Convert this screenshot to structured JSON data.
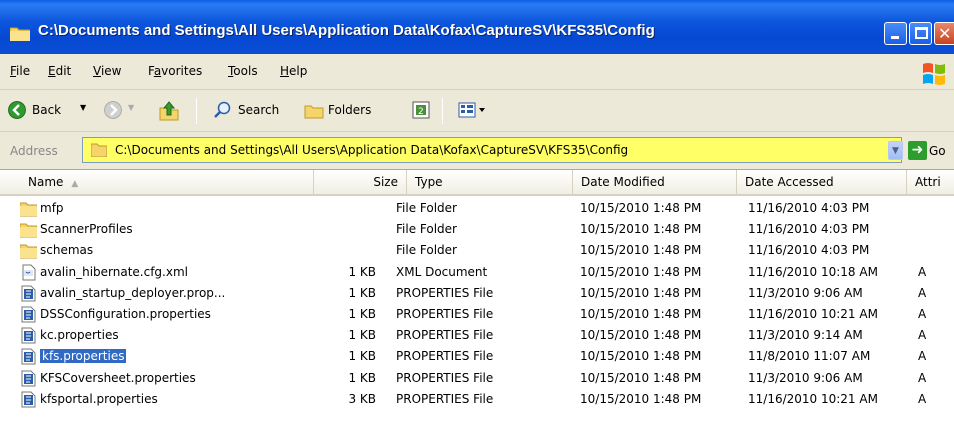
{
  "window": {
    "title": "C:\\Documents and Settings\\All Users\\Application Data\\Kofax\\CaptureSV\\KFS35\\Config"
  },
  "menu": [
    {
      "label": "File",
      "key": "F",
      "rest": "ile"
    },
    {
      "label": "Edit",
      "key": "E",
      "rest": "dit"
    },
    {
      "label": "View",
      "key": "V",
      "rest": "iew"
    },
    {
      "label": "Favorites",
      "key": "a",
      "rest": "vorites",
      "prefix": "F"
    },
    {
      "label": "Tools",
      "key": "T",
      "rest": "ools"
    },
    {
      "label": "Help",
      "key": "H",
      "rest": "elp"
    }
  ],
  "toolbar": {
    "back_label": "Back",
    "search_label": "Search",
    "folders_label": "Folders"
  },
  "address": {
    "label": "Address",
    "value": "C:\\Documents and Settings\\All Users\\Application Data\\Kofax\\CaptureSV\\KFS35\\Config",
    "go_label": "Go"
  },
  "columns": {
    "name": "Name",
    "size": "Size",
    "type": "Type",
    "modified": "Date Modified",
    "accessed": "Date Accessed",
    "attributes": "Attri"
  },
  "files": [
    {
      "name": "mfp",
      "size": "",
      "type": "File Folder",
      "modified": "10/15/2010 1:48 PM",
      "accessed": "11/16/2010 4:03 PM",
      "attr": "",
      "icon": "folder-icon"
    },
    {
      "name": "ScannerProfiles",
      "size": "",
      "type": "File Folder",
      "modified": "10/15/2010 1:48 PM",
      "accessed": "11/16/2010 4:03 PM",
      "attr": "",
      "icon": "folder-icon"
    },
    {
      "name": "schemas",
      "size": "",
      "type": "File Folder",
      "modified": "10/15/2010 1:48 PM",
      "accessed": "11/16/2010 4:03 PM",
      "attr": "",
      "icon": "folder-icon"
    },
    {
      "name": "avalin_hibernate.cfg.xml",
      "size": "1 KB",
      "type": "XML Document",
      "modified": "10/15/2010 1:48 PM",
      "accessed": "11/16/2010 10:18 AM",
      "attr": "A",
      "icon": "xml-file-icon"
    },
    {
      "name": "avalin_startup_deployer.prop...",
      "size": "1 KB",
      "type": "PROPERTIES File",
      "modified": "10/15/2010 1:48 PM",
      "accessed": "11/3/2010 9:06 AM",
      "attr": "A",
      "icon": "properties-file-icon"
    },
    {
      "name": "DSSConfiguration.properties",
      "size": "1 KB",
      "type": "PROPERTIES File",
      "modified": "10/15/2010 1:48 PM",
      "accessed": "11/16/2010 10:21 AM",
      "attr": "A",
      "icon": "properties-file-icon"
    },
    {
      "name": "kc.properties",
      "size": "1 KB",
      "type": "PROPERTIES File",
      "modified": "10/15/2010 1:48 PM",
      "accessed": "11/3/2010 9:14 AM",
      "attr": "A",
      "icon": "properties-file-icon"
    },
    {
      "name": "kfs.properties",
      "size": "1 KB",
      "type": "PROPERTIES File",
      "modified": "10/15/2010 1:48 PM",
      "accessed": "11/8/2010 11:07 AM",
      "attr": "A",
      "icon": "properties-file-icon",
      "selected": true
    },
    {
      "name": "KFSCoversheet.properties",
      "size": "1 KB",
      "type": "PROPERTIES File",
      "modified": "10/15/2010 1:48 PM",
      "accessed": "11/3/2010 9:06 AM",
      "attr": "A",
      "icon": "properties-file-icon"
    },
    {
      "name": "kfsportal.properties",
      "size": "3 KB",
      "type": "PROPERTIES File",
      "modified": "10/15/2010 1:48 PM",
      "accessed": "11/16/2010 10:21 AM",
      "attr": "A",
      "icon": "properties-file-icon"
    }
  ],
  "colors": {
    "titlebar": "#0648d2",
    "address_highlight": "#ffff66",
    "selection": "#316ac5"
  }
}
